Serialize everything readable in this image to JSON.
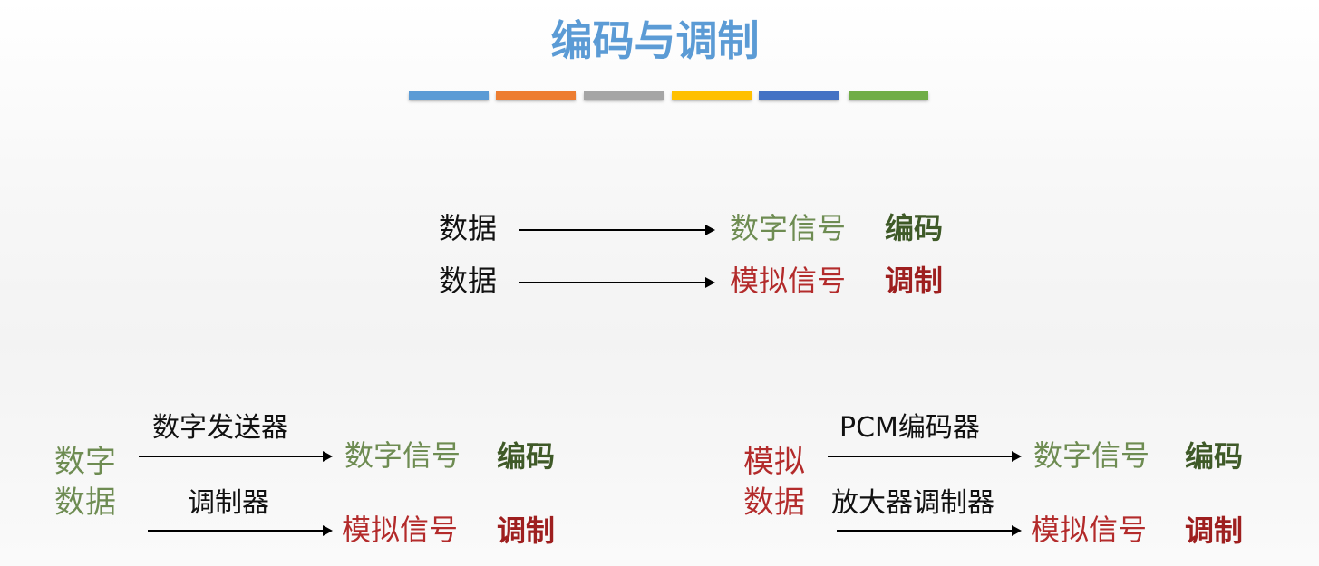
{
  "watermark": "",
  "title": "编码与调制",
  "colors": {
    "title": "#5b9bd5",
    "green": "#6e8c52",
    "dark_green": "#3f5a28",
    "red": "#b32b2b",
    "dark_red": "#9e1f1f",
    "black": "#111111"
  },
  "color_bars": [
    "#5b9bd5",
    "#ed7d31",
    "#a5a5a5",
    "#ffc000",
    "#4472c4",
    "#70ad47"
  ],
  "top_rows": [
    {
      "source": "数据",
      "target": "数字信号",
      "method": "编码"
    },
    {
      "source": "数据",
      "target": "模拟信号",
      "method": "调制"
    }
  ],
  "left_group": {
    "source_line1": "数字",
    "source_line2": "数据",
    "upper_device": "数字发送器",
    "upper_target": "数字信号",
    "upper_method": "编码",
    "lower_device": "调制器",
    "lower_target": "模拟信号",
    "lower_method": "调制"
  },
  "right_group": {
    "source_line1": "模拟",
    "source_line2": "数据",
    "upper_device": "PCM编码器",
    "upper_target": "数字信号",
    "upper_method": "编码",
    "lower_device": "放大器调制器",
    "lower_target": "模拟信号",
    "lower_method": "调制"
  }
}
